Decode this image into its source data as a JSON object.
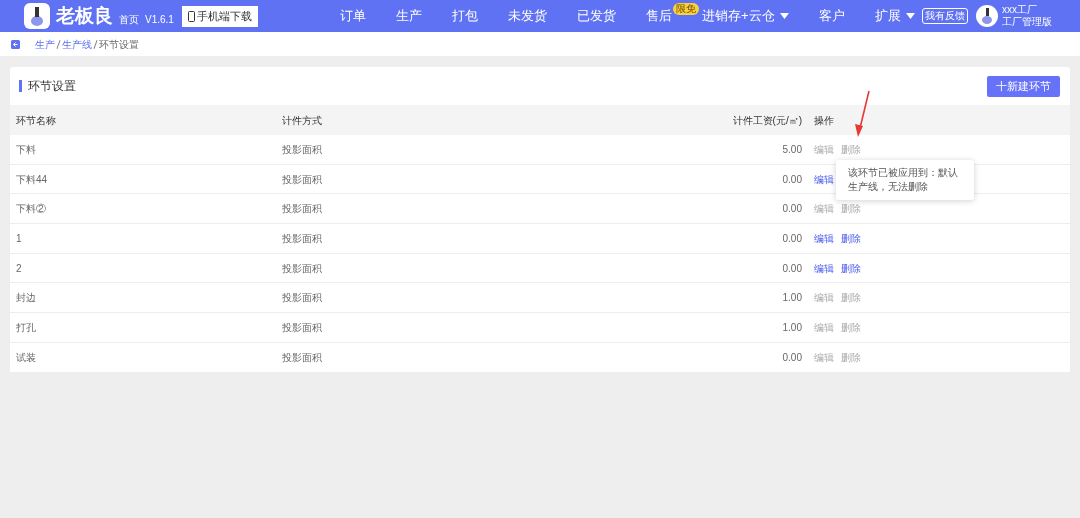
{
  "header": {
    "brand": "老板良",
    "home": "首页",
    "version": "V1.6.1",
    "download_button": "手机端下载",
    "nav": [
      {
        "label": "订单",
        "dropdown": false
      },
      {
        "label": "生产",
        "dropdown": false
      },
      {
        "label": "打包",
        "dropdown": false
      },
      {
        "label": "未发货",
        "dropdown": false
      },
      {
        "label": "已发货",
        "dropdown": false
      },
      {
        "label": "售后",
        "dropdown": false,
        "badge": "限免"
      },
      {
        "label": "进销存+云仓",
        "dropdown": true
      },
      {
        "label": "客户",
        "dropdown": false
      },
      {
        "label": "扩展",
        "dropdown": true
      }
    ],
    "feedback": "我有反馈",
    "user": {
      "name": "xxx工厂",
      "role": "工厂管理版"
    }
  },
  "breadcrumb": [
    {
      "label": "生产",
      "link": true
    },
    {
      "label": "生产线",
      "link": true
    },
    {
      "label": "环节设置",
      "link": false
    }
  ],
  "card": {
    "title": "环节设置",
    "new_button": "十新建环节",
    "table": {
      "columns": [
        "环节名称",
        "计件方式",
        "计件工资(元/㎡)",
        "操作"
      ],
      "rows": [
        {
          "name": "下料",
          "method": "投影面积",
          "wage": "5.00",
          "edit": "编辑",
          "edit_enabled": false,
          "delete": "删除",
          "delete_enabled": false
        },
        {
          "name": "下料44",
          "method": "投影面积",
          "wage": "0.00",
          "edit": "编辑",
          "edit_enabled": true
        },
        {
          "name": "下料②",
          "method": "投影面积",
          "wage": "0.00",
          "edit": "编辑",
          "edit_enabled": false,
          "delete": "删除",
          "delete_enabled": false
        },
        {
          "name": "1",
          "method": "投影面积",
          "wage": "0.00",
          "edit": "编辑",
          "edit_enabled": true,
          "delete": "删除",
          "delete_enabled": true
        },
        {
          "name": "2",
          "method": "投影面积",
          "wage": "0.00",
          "edit": "编辑",
          "edit_enabled": true,
          "delete": "删除",
          "delete_enabled": true
        },
        {
          "name": "封边",
          "method": "投影面积",
          "wage": "1.00",
          "edit": "编辑",
          "edit_enabled": false,
          "delete": "删除",
          "delete_enabled": false
        },
        {
          "name": "打孔",
          "method": "投影面积",
          "wage": "1.00",
          "edit": "编辑",
          "edit_enabled": false,
          "delete": "删除",
          "delete_enabled": false
        },
        {
          "name": "试装",
          "method": "投影面积",
          "wage": "0.00",
          "edit": "编辑",
          "edit_enabled": false,
          "delete": "删除",
          "delete_enabled": false
        }
      ]
    }
  },
  "tooltip": {
    "text": "该环节已被应用到：默认生产线，无法删除"
  }
}
